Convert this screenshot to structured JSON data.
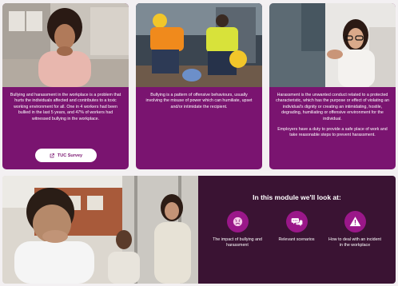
{
  "cards": [
    {
      "paragraphs": [
        "Bullying and harassment in the workplace is a problem that hurts the individuals affected and contributes to a toxic working environment for all. One in 4 workers had been bullied in the last 5 years, and 47% of workers had witnessed bullying in the workplace."
      ],
      "button_label": "TUC Survey"
    },
    {
      "paragraphs": [
        "Bullying is a pattern of offensive behaviours, usually involving the misuse of power which can humiliate, upset and/or intimidate the recipient."
      ]
    },
    {
      "paragraphs": [
        "Harassment is the unwanted conduct related to a protected characteristic, which has the purpose or effect of violating an individual's dignity or creating an intimidating, hostile, degrading, humiliating or offensive environment for the individual.",
        "Employers have a duty to provide a safe place of work and take reasonable steps to prevent harassment."
      ]
    }
  ],
  "module": {
    "title": "In this module we'll look at:",
    "topics": [
      {
        "label": "The impact of bullying and harassment",
        "icon": "sad-face-icon"
      },
      {
        "label": "Relevant scenarios",
        "icon": "chat-bubbles-icon"
      },
      {
        "label": "How to deal with an incident in the workplace",
        "icon": "warning-icon"
      }
    ]
  },
  "colors": {
    "card_purple": "#7a1470",
    "panel_dark": "#3a1333",
    "icon_circle": "#9a1789",
    "button_bg": "#ffffff"
  }
}
